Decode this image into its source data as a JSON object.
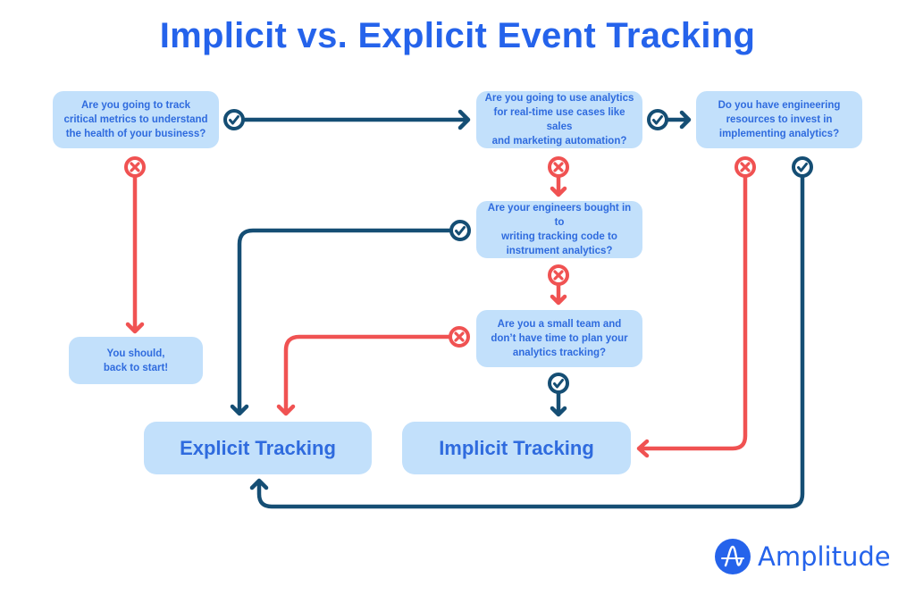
{
  "title": "Implicit vs. Explicit Event Tracking",
  "colors": {
    "title": "#2563eb",
    "box_fill": "#c2e0fb",
    "box_text": "#2f6bde",
    "yes_path": "#154e74",
    "no_path": "#f05252"
  },
  "nodes": {
    "q1": "Are you going to track\ncritical metrics to understand\nthe health of your business?",
    "q2": "Are you going to use analytics\nfor real-time use cases like sales\nand marketing automation?",
    "q3": "Do you have engineering\nresources to invest in\nimplementing analytics?",
    "q4": "Are your engineers bought in to\nwriting tracking code to\ninstrument analytics?",
    "q5": "Are you a small team and\ndon’t have time to plan your\nanalytics tracking?",
    "restart": "You should,\nback to start!",
    "explicit": "Explicit Tracking",
    "implicit": "Implicit Tracking"
  },
  "edges": [
    {
      "from": "q1",
      "to": "q2",
      "answer": "yes"
    },
    {
      "from": "q1",
      "to": "restart",
      "answer": "no"
    },
    {
      "from": "q2",
      "to": "q3",
      "answer": "yes"
    },
    {
      "from": "q2",
      "to": "q4",
      "answer": "no"
    },
    {
      "from": "q3",
      "to": "implicit",
      "answer": "no"
    },
    {
      "from": "q3",
      "to": "explicit",
      "answer": "yes"
    },
    {
      "from": "q4",
      "to": "explicit",
      "answer": "yes"
    },
    {
      "from": "q4",
      "to": "q5",
      "answer": "no"
    },
    {
      "from": "q5",
      "to": "explicit",
      "answer": "no"
    },
    {
      "from": "q5",
      "to": "implicit",
      "answer": "yes"
    }
  ],
  "icons": {
    "yes": "check-circle-icon",
    "no": "x-circle-icon"
  },
  "logo": {
    "text": "Amplitude",
    "icon": "amplitude-wave-icon"
  }
}
